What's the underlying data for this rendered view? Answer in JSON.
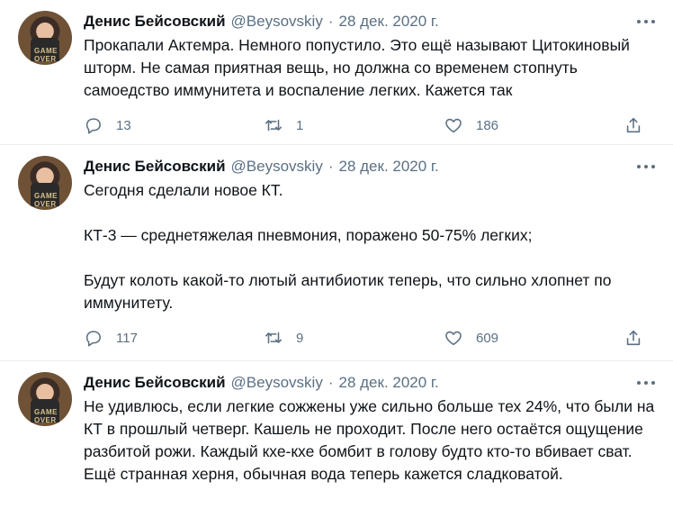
{
  "tweets": [
    {
      "name": "Денис Бейсовский",
      "handle": "@Beysovskiy",
      "date": "28 дек. 2020 г.",
      "text": "Прокапали Актемра. Немного попустило. Это ещё называют Цитокиновый шторм. Не самая приятная вещь, но должна со временем стопнуть самоедство иммунитета и воспаление легких. Кажется так",
      "replies": "13",
      "retweets": "1",
      "likes": "186"
    },
    {
      "name": "Денис Бейсовский",
      "handle": "@Beysovskiy",
      "date": "28 дек. 2020 г.",
      "text": "Сегодня сделали новое КТ.\n\nКТ-3 — среднетяжелая пневмония, поражено 50-75% легких;\n\nБудут колоть какой-то лютый антибиотик теперь, что сильно хлопнет по иммунитету.",
      "replies": "117",
      "retweets": "9",
      "likes": "609"
    },
    {
      "name": "Денис Бейсовский",
      "handle": "@Beysovskiy",
      "date": "28 дек. 2020 г.",
      "text": "Не удивлюсь, если легкие сожжены уже сильно больше тех 24%, что были на КТ в прошлый четверг. Кашель не проходит. После него остаётся ощущение разбитой рожи. Каждый кхе-кхе бомбит в голову будто кто-то вбивает сват. Ещё странная херня, обычная вода теперь кажется сладковатой.",
      "replies": "",
      "retweets": "",
      "likes": ""
    }
  ],
  "avatar_badge": "GAME OVER",
  "meta_separator": "·"
}
